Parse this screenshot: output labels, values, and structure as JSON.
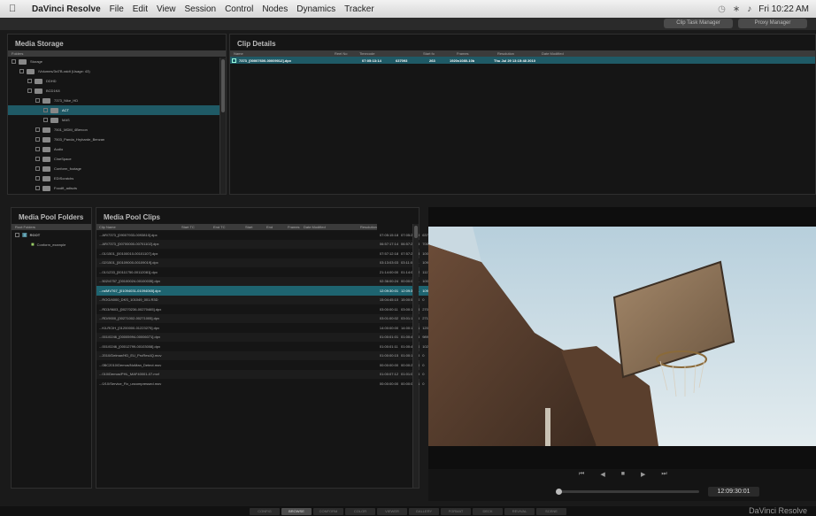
{
  "menubar": {
    "app": "DaVinci Resolve",
    "items": [
      "File",
      "Edit",
      "View",
      "Session",
      "Control",
      "Nodes",
      "Dynamics",
      "Tracker"
    ],
    "clock": "Fri 10:22 AM"
  },
  "top_buttons": [
    "Clip Task Manager",
    "Proxy Manager"
  ],
  "media_storage": {
    "title": "Media Storage",
    "header": "Folders",
    "items": [
      {
        "label": "Storage",
        "indent": 0
      },
      {
        "label": "/Volumes/3xl7B-raidt (Usage: 43)",
        "indent": 1
      },
      {
        "label": "DDHD",
        "indent": 2
      },
      {
        "label": "BCD1K8",
        "indent": 2
      },
      {
        "label": "7373_Nike_HD",
        "indent": 3
      },
      {
        "label": "ACT",
        "indent": 4,
        "selected": true
      },
      {
        "label": "MAS",
        "indent": 4
      },
      {
        "label": "7501_MDM_4Bercon",
        "indent": 3
      },
      {
        "label": "7503_Panda_Hryharde_Benzan",
        "indent": 3
      },
      {
        "label": "Audio",
        "indent": 3
      },
      {
        "label": "CineSpace",
        "indent": 3
      },
      {
        "label": "Conform_footage",
        "indent": 3
      },
      {
        "label": "EDIScratchs",
        "indent": 3
      },
      {
        "label": "Foodft_adiscts",
        "indent": 3
      },
      {
        "label": "HP_RED002",
        "indent": 3
      },
      {
        "label": "INC_EXLS",
        "indent": 3
      }
    ]
  },
  "clip_details": {
    "title": "Clip Details",
    "columns": [
      "Name",
      "Reel No",
      "Timecode",
      "Start fo",
      "Frames",
      "Resolution",
      "Date Modified"
    ],
    "row": [
      "7373_[00007600-00009012].dpx",
      "",
      "07:05:13:14",
      "637093",
      "263",
      "1920x1080-10b",
      "Thu Jul 29 13:15:48 2010"
    ]
  },
  "pool_folders": {
    "title": "Media Pool Folders",
    "header": "Root Folders",
    "items": [
      "ROOT",
      "Conform_example"
    ]
  },
  "pool_clips": {
    "title": "Media Pool Clips",
    "columns": [
      "Clip Name",
      "Start TC",
      "End TC",
      "Start",
      "End",
      "Frames",
      "Date Modified",
      "Resolution"
    ],
    "rows": [
      [
        "...AR/7373_[09007933-0093810].dpx",
        "07:05:15:18",
        "07:05:29:28",
        "637093",
        "630165",
        "263",
        "Thu Jul 29 13:15:45 2010",
        "1920x1080-10b"
      ],
      [
        "...AR/7373_[00700000-00701102].dpx",
        "06:57:17:14",
        "06:57:29:28",
        "700000",
        "701102",
        "323",
        "Thu Jul 29 13:16:04 2010",
        "1920x1080-10b"
      ],
      [
        "...01/1501_[00100010-00101107].dpx",
        "07:57:12:18",
        "07:57:29:28",
        "100018",
        "101107",
        "240",
        "Thu Jul 29 13:10:03 2010",
        "1920x1080-10b"
      ],
      [
        "...02/1501_[00109000-00109019].dpx",
        "03:13:03:03",
        "03:11:04:11",
        "109000",
        "109819",
        "305",
        "Thu Jul 29 13:10:57 2010",
        "1920x1080-10b"
      ],
      [
        "...01/1233_[00111750-00112081].dpx",
        "21:14:00:00",
        "01:14:02:12",
        "111750",
        "112081",
        "212",
        "Thu Jul 29 13:20:09 2010",
        "2048x1536-10b"
      ],
      [
        "...502/4757_[00100024-00100035].dpx",
        "02:36:00:24",
        "00:00:00:11",
        "100024",
        "100035",
        "212",
        "Thu Jul 29 13:10:00 2010",
        "1920x1080-10b"
      ],
      [
        "...ra/MV767_[01094031-01094065].dpx",
        "12:09:30:01",
        "12:09:37:11",
        "1094031",
        "1094065",
        "193",
        "Thu Jul 29 13:15:42 2010",
        "1920x1080-10b"
      ],
      [
        "...ROG/4000_DKS_101049_001.R3D",
        "15:04:45:10",
        "15:00:57:00",
        "0",
        "346",
        "300",
        "Sat Oct 16 19:06:00 2009",
        "2048x1024-10b"
      ],
      [
        "...RD3/9603_[00270236-00270465].dpx",
        "03:00:00:11",
        "03:00:10:18",
        "270236",
        "270465",
        "230",
        "Thu Jul 29 13:10:04 2010",
        "1920x1080-10b"
      ],
      [
        "...RD/9000_[00271002-00271005].dpx",
        "03:01:00:02",
        "03:01:13:26",
        "271002",
        "271005",
        "204",
        "Thu Jul 29 13:10:46 2010",
        "1920x1080-10b"
      ],
      [
        "...K/LRCIH_[01200000-01223275].dpx",
        "14:00:00:00",
        "14:00:17:01",
        "1200000",
        "1223275",
        "10576",
        "Tue Sep 22 05:32:02 2009",
        "1920x1536-10b"
      ],
      [
        "...001/0246_[00005994-00006071].dpx",
        "01:00:01:01",
        "01:00:46:04",
        "98994",
        "99071",
        "275",
        "Fri Sep 4 05:24:00 2009",
        "2048x1556-10b"
      ],
      [
        "...001/0246_[00012799-00103008].dpx",
        "01:00:01:11",
        "01:00:46:10",
        "102799",
        "103008",
        "224",
        "Fri Sep 4 05:24:04 2009",
        "2048x1556-10b"
      ],
      [
        "...2010/Delmar/HD_EU_ProRes4Q.mov",
        "01:00:00:15",
        "01:00:13:18",
        "0",
        "202",
        "201",
        "Tue Sep 22 14:00:18 2009",
        "1920x1080-10b"
      ],
      [
        "...0BC2010/Demos/NoMan_Detect.mov",
        "00:00:00:00",
        "00:00:20:20",
        "0",
        "756",
        "753",
        "Wed Aug 4 12:00:29 2010",
        "720x576-8b"
      ],
      [
        "...010/Demos/PHL_MAF40001-07.mxf",
        "01:00:07:12",
        "01:01:04:04",
        "0",
        "1406",
        "1407",
        "Wed Aug 4 12:00:49 2010",
        "720x576-8b"
      ],
      [
        "...0/10/Service_Fix_uncompressed.mov",
        "00:00:00:00",
        "00:00:00:21",
        "0",
        "740",
        "201",
        "Thu Jul 30 12:07:54 2009",
        "720x576-10b"
      ]
    ]
  },
  "viewer": {
    "timecode": "12:09:30:01",
    "controls": [
      "skip-back",
      "step-back",
      "stop",
      "play",
      "skip-forward"
    ]
  },
  "bottom_nav": [
    "CONFIG",
    "BROWSE",
    "CONFORM",
    "COLOR",
    "VIEWER",
    "GALLERY",
    "FORMAT",
    "DECK",
    "REVIVAL",
    "SCENE"
  ],
  "bottom_nav_active": "BROWSE",
  "brand": "DaVinci Resolve"
}
